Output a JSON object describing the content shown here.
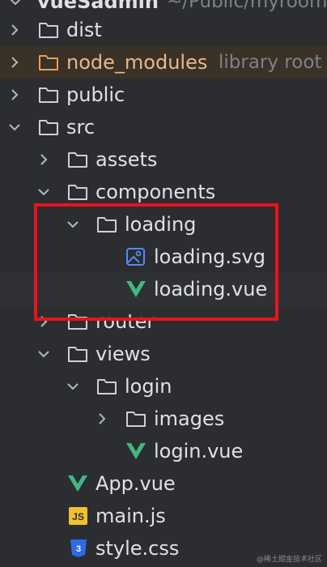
{
  "header": {
    "project_name": "vueSadmin",
    "project_path": "~/Public/myroom"
  },
  "tree": [
    {
      "label": "dist"
    },
    {
      "label": "node_modules",
      "hint": "library root"
    },
    {
      "label": "public"
    },
    {
      "label": "src"
    },
    {
      "label": "assets"
    },
    {
      "label": "components"
    },
    {
      "label": "loading"
    },
    {
      "label": "loading.svg"
    },
    {
      "label": "loading.vue"
    },
    {
      "label": "router"
    },
    {
      "label": "views"
    },
    {
      "label": "login"
    },
    {
      "label": "images"
    },
    {
      "label": "login.vue"
    },
    {
      "label": "App.vue"
    },
    {
      "label": "main.js"
    },
    {
      "label": "style.css"
    }
  ],
  "icons": {
    "js_badge": "JS",
    "css_badge": "3"
  },
  "watermark": "@稀土掘金技术社区",
  "colors": {
    "background": "#2b2d30",
    "library_row": "#3a3127",
    "highlight_border": "#e8141b",
    "vue_green": "#41b883",
    "js_yellow": "#f0c02f",
    "css_blue": "#2f6ae6"
  }
}
